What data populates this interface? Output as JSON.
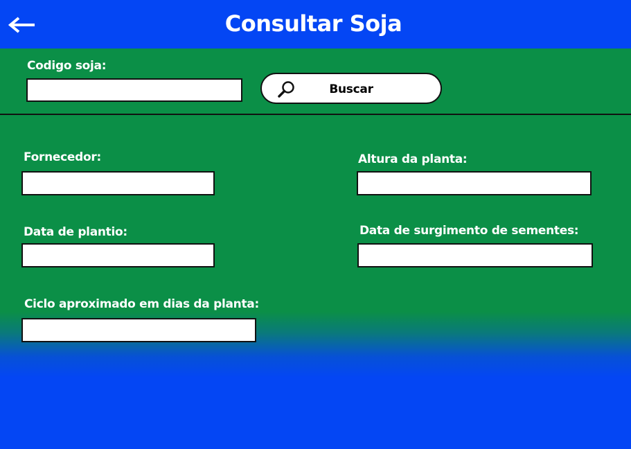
{
  "header": {
    "title": "Consultar Soja",
    "back_icon": "arrow-left-icon"
  },
  "search": {
    "codigo_label": "Codigo soja:",
    "codigo_value": "",
    "button_label": "Buscar",
    "button_icon": "search-icon"
  },
  "fields": {
    "fornecedor": {
      "label": "Fornecedor:",
      "value": ""
    },
    "altura": {
      "label": "Altura da planta:",
      "value": ""
    },
    "data_plantio": {
      "label": "Data de plantio:",
      "value": ""
    },
    "data_sementes": {
      "label": "Data de surgimento de sementes:",
      "value": ""
    },
    "ciclo": {
      "label": "Ciclo aproximado em dias da planta:",
      "value": ""
    }
  },
  "colors": {
    "header_blue": "#0446f4",
    "form_green": "#0b8f47",
    "text_white": "#ffffff",
    "border_black": "#111111"
  }
}
